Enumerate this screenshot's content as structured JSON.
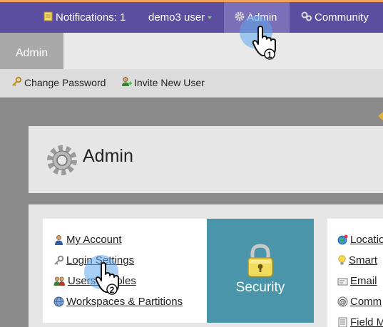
{
  "topbar": {
    "notifications_label": "Notifications: 1",
    "user_label": "demo3 user",
    "admin_label": "Admin",
    "community_label": "Community"
  },
  "tabs": [
    {
      "label": "Admin",
      "active": true
    }
  ],
  "toolbar": {
    "change_password_label": "Change Password",
    "invite_user_label": "Invite New User"
  },
  "page": {
    "title": "Admin"
  },
  "security_links": [
    {
      "label": "My Account",
      "icon": "user-icon"
    },
    {
      "label": "Login Settings",
      "icon": "key-icon"
    },
    {
      "label": "Users & Roles",
      "icon": "users-icon"
    },
    {
      "label": "Workspaces & Partitions",
      "icon": "globe-icon"
    }
  ],
  "security_tile": {
    "label": "Security",
    "icon": "padlock-icon"
  },
  "right_links": [
    {
      "label": "Location",
      "icon": "location-globe-icon"
    },
    {
      "label": "Smart",
      "icon": "lightbulb-icon"
    },
    {
      "label": "Email",
      "icon": "email-icon"
    },
    {
      "label": "Comm",
      "icon": "at-sign-icon"
    },
    {
      "label": "Field M",
      "icon": "field-icon"
    }
  ],
  "steps": {
    "step1": "1",
    "step2": "2"
  },
  "colors": {
    "topbar": "#5b4ea0",
    "topbar_active": "#7b70b8",
    "topbar_accent": "#f0a35a",
    "security_tile": "#4a95a9",
    "callout_halo": "#5fa5eb"
  }
}
